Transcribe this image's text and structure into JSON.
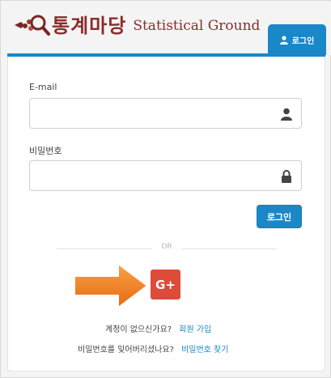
{
  "brand": {
    "title_ko": "통계마당",
    "title_en": "Statistical Ground"
  },
  "header": {
    "login_tab_label": "로그인"
  },
  "form": {
    "email_label": "E-mail",
    "email_value": "",
    "password_label": "비밀번호",
    "password_value": "",
    "login_button_label": "로그인",
    "divider_text": "OR",
    "google_button_label": "G+"
  },
  "footer_links": {
    "no_account_text": "계정이 없으신가요?",
    "signup_link": "회원 가입",
    "forgot_text": "비밀번호를 잊어버리셨나요?",
    "forgot_link": "비밀번호 찾기"
  },
  "colors": {
    "accent": "#1a87c8",
    "brand": "#8a2d2a",
    "google": "#dd4b39",
    "arrow": "#f07c1c"
  },
  "icons": {
    "logo": "magnifier-logo-icon",
    "user_tab": "user-icon",
    "email_field": "user-icon",
    "password_field": "lock-icon",
    "callout": "arrow-right-icon"
  }
}
